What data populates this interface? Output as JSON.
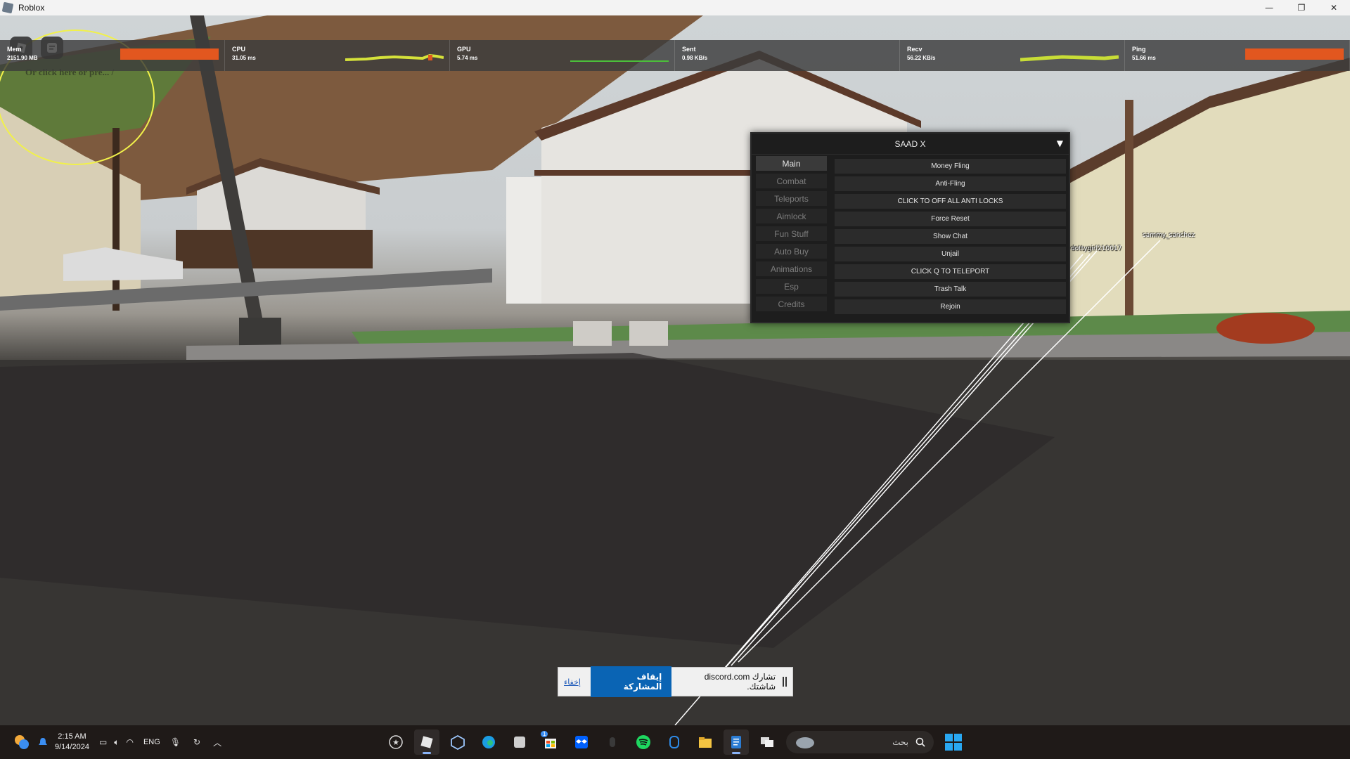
{
  "window": {
    "title": "Roblox",
    "controls": {
      "minimize": "—",
      "restore": "❐",
      "close": "✕"
    }
  },
  "stats": [
    {
      "label": "Mem",
      "value": "2151.90 MB"
    },
    {
      "label": "CPU",
      "value": "31.05 ms"
    },
    {
      "label": "GPU",
      "value": "5.74 ms"
    },
    {
      "label": "Sent",
      "value": "0.98 KB/s"
    },
    {
      "label": "Recv",
      "value": "56.22 KB/s"
    },
    {
      "label": "Ping",
      "value": "51.66 ms"
    }
  ],
  "hint_text": "Or click here or pre... /",
  "menu": {
    "title": "SAAD X",
    "toggle": "▼",
    "tabs": [
      "Main",
      "Combat",
      "Teleports",
      "Aimlock",
      "Fun Stuff",
      "Auto Buy",
      "Animations",
      "Esp",
      "Credits"
    ],
    "active_tab": "Main",
    "buttons": [
      "Money Fling",
      "Anti-Fling",
      "CLICK TO OFF ALL ANTI LOCKS",
      "Force Reset",
      "Show Chat",
      "Unjail",
      "CLICK Q TO TELEPORT",
      "Trash Talk",
      "Rejoin"
    ]
  },
  "players": [
    {
      "name": "dottygirl210017"
    },
    {
      "name": "sammy_sanchez"
    }
  ],
  "share_bar": {
    "text": "تشارك discord.com شاشتك.",
    "stop_label": "إيقاف المشاركة",
    "hide_label": "إخفاء"
  },
  "taskbar": {
    "time": "2:15 AM",
    "date": "9/14/2024",
    "language": "ENG",
    "search_placeholder": "بحث",
    "apps": [
      "favorites-icon",
      "roblox-icon",
      "box-icon",
      "edge-icon",
      "notepad-icon",
      "store-icon",
      "dropbox-icon",
      "mouse-icon",
      "spotify-icon",
      "controller-icon",
      "folder-icon",
      "document-icon",
      "window-icon"
    ],
    "store_badge": "1"
  }
}
